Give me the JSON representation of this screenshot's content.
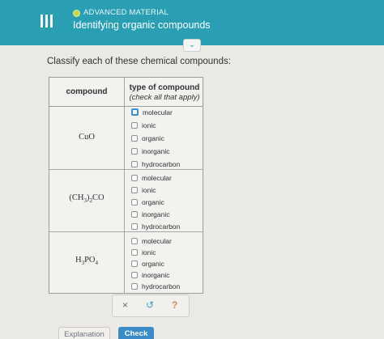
{
  "header": {
    "subject": "ADVANCED MATERIAL",
    "topic": "Identifying organic compounds",
    "collapse_icon": "chevron-down-icon",
    "menu_icon": "hamburger-icon",
    "accent_color": "#2a9fb4"
  },
  "question": {
    "instruction": "Classify each of these chemical compounds:"
  },
  "table": {
    "col_compound": "compound",
    "col_type": "type of compound",
    "col_type_hint": "(check all that apply)",
    "rows": [
      {
        "formula": {
          "main": "CuO"
        },
        "options": [
          "molecular",
          "ionic",
          "organic",
          "inorganic",
          "hydrocarbon"
        ]
      },
      {
        "formula": {
          "a": "(CH",
          "a_sub": "3",
          "b": ")",
          "b_sub": "2",
          "c": "CO"
        },
        "options": [
          "molecular",
          "ionic",
          "organic",
          "inorganic",
          "hydrocarbon"
        ]
      },
      {
        "formula": {
          "a": "H",
          "a_sub": "3",
          "b": "PO",
          "b_sub": "4"
        },
        "options": [
          "molecular",
          "ionic",
          "organic",
          "inorganic",
          "hydrocarbon"
        ]
      }
    ]
  },
  "toolbar": {
    "clear_symbol": "×",
    "undo_symbol": "↺",
    "help_symbol": "?"
  },
  "footer": {
    "explanation_label": "Explanation",
    "check_label": "Check"
  }
}
